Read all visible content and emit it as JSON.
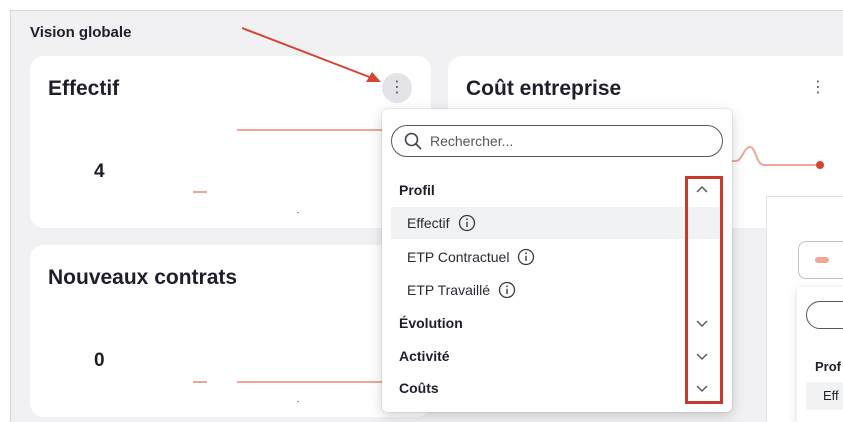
{
  "section": {
    "title": "Vision globale"
  },
  "cards": {
    "effectif": {
      "title": "Effectif",
      "value": "4"
    },
    "cout": {
      "title": "Coût entreprise"
    },
    "nouveaux": {
      "title": "Nouveaux contrats",
      "value": "0"
    }
  },
  "dropdown": {
    "search_placeholder": "Rechercher...",
    "groups": [
      {
        "label": "Profil",
        "expanded": true,
        "items": [
          {
            "label": "Effectif",
            "selected": true
          },
          {
            "label": "ETP Contractuel",
            "selected": false
          },
          {
            "label": "ETP Travaillé",
            "selected": false
          }
        ]
      },
      {
        "label": "Évolution",
        "expanded": false
      },
      {
        "label": "Activité",
        "expanded": false
      },
      {
        "label": "Coûts",
        "expanded": false
      }
    ]
  },
  "background_panel": {
    "label_partial": "Prof",
    "item_partial": "Eff"
  },
  "colors": {
    "accent_trend": "#f0a896",
    "arrow": "#d6452f",
    "highlight_box": "#c8392b",
    "selected_bg": "#f1f2f4"
  }
}
